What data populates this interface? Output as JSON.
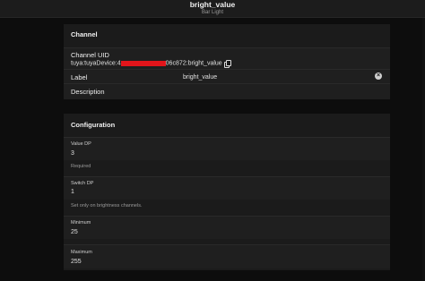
{
  "header": {
    "title": "bright_value",
    "subtitle": "Bar Light"
  },
  "channel": {
    "section_title": "Channel",
    "uid_label": "Channel UID",
    "uid_prefix": "tuya:tuyaDevice:4",
    "uid_suffix": "06c872:bright_value",
    "label_field": {
      "label": "Label",
      "value": "bright_value"
    },
    "description_field": {
      "label": "Description",
      "value": ""
    }
  },
  "configuration": {
    "section_title": "Configuration",
    "fields": [
      {
        "label": "Value DP",
        "value": "3",
        "hint": "Required"
      },
      {
        "label": "Switch DP",
        "value": "1",
        "hint": "Set only on brightness channels."
      },
      {
        "label": "Minimum",
        "value": "25",
        "hint": ""
      },
      {
        "label": "Maximum",
        "value": "255",
        "hint": ""
      }
    ]
  },
  "colors": {
    "redaction": "#e2151b",
    "background": "#0d0d0d",
    "panel": "#1b1b1b"
  }
}
